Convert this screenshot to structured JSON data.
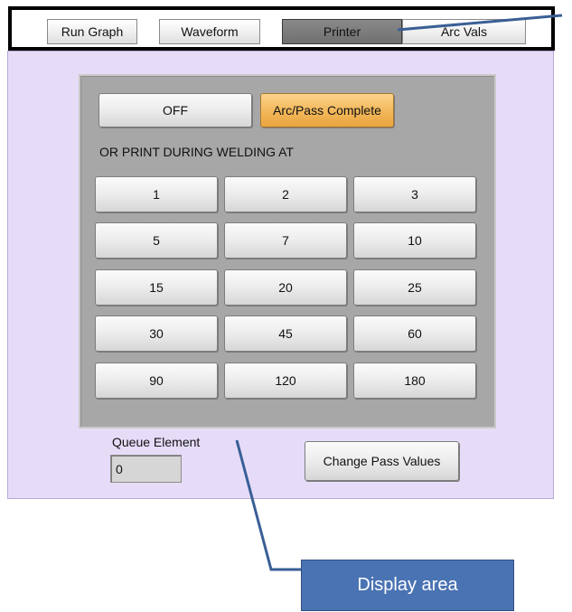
{
  "tabs": [
    {
      "label": "Run Graph",
      "active": false
    },
    {
      "label": "Waveform",
      "active": false
    },
    {
      "label": "Printer",
      "active": true
    },
    {
      "label": "Arc Vals",
      "active": false
    }
  ],
  "mode_buttons": {
    "off": "OFF",
    "complete": "Arc/Pass Complete"
  },
  "prompt": "OR PRINT DURING WELDING AT",
  "interval_buttons": [
    "1",
    "2",
    "3",
    "5",
    "7",
    "10",
    "15",
    "20",
    "25",
    "30",
    "45",
    "60",
    "90",
    "120",
    "180"
  ],
  "queue": {
    "label": "Queue Element",
    "value": "0"
  },
  "change_pass_button": "Change Pass Values",
  "callout": {
    "label": "Display area"
  },
  "colors": {
    "panel_bg": "#e6dcf8",
    "inner_bg": "#a7a7a7",
    "active_tab": "#7a7a7a",
    "orange_button": "#f3b95c",
    "callout_bg": "#4a73b3",
    "callout_line": "#3a5f96"
  }
}
